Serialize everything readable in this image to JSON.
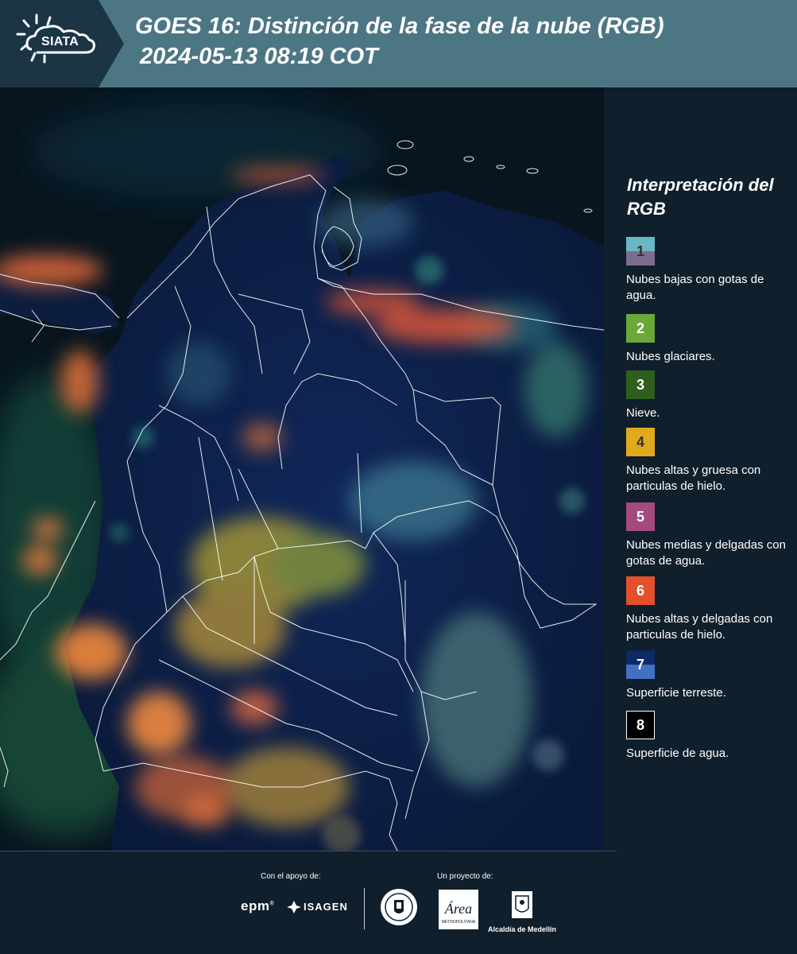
{
  "header": {
    "logo_text": "SIATA",
    "title": "GOES 16: Distinción de la fase de la nube (RGB)",
    "subtitle": "2024-05-13 08:19 COT"
  },
  "legend": {
    "title": "Interpretación del RGB",
    "items": [
      {
        "number": "1",
        "label": "Nubes bajas con gotas de agua.",
        "color_top": "#6ab7c4",
        "color_bottom": "#7a6e8c",
        "num_color": "#333333"
      },
      {
        "number": "2",
        "label": "Nubes glaciares.",
        "color_top": "#6aa83a",
        "color_bottom": "#6aa83a",
        "num_color": "#ffffff"
      },
      {
        "number": "3",
        "label": "Nieve.",
        "color_top": "#2f5e1e",
        "color_bottom": "#2f5e1e",
        "num_color": "#ffffff"
      },
      {
        "number": "4",
        "label": "Nubes altas y gruesa con particulas de hielo.",
        "color_top": "#e0aa1c",
        "color_bottom": "#e0aa1c",
        "num_color": "#333333"
      },
      {
        "number": "5",
        "label": "Nubes medias y delgadas con gotas de agua.",
        "color_top": "#a54a7e",
        "color_bottom": "#a54a7e",
        "num_color": "#ffffff"
      },
      {
        "number": "6",
        "label": "Nubes altas y delgadas con particulas de hielo.",
        "color_top": "#e4502c",
        "color_bottom": "#e4502c",
        "num_color": "#ffffff"
      },
      {
        "number": "7",
        "label": "Superficie terreste.",
        "color_top": "#0e2a66",
        "color_bottom": "#4470c4",
        "num_color": "#ffffff"
      },
      {
        "number": "8",
        "label": "Superficie de agua.",
        "color_top": "#000000",
        "color_bottom": "#000000",
        "num_color": "#ffffff"
      }
    ]
  },
  "footer": {
    "support_label": "Con el apoyo de:",
    "project_label": "Un proyecto de:",
    "epm": "epm",
    "isagen": "ISAGEN",
    "alcaldia": "Alcaldía de Medellín",
    "area_word": "Área",
    "area_sub": "METROPOLITANA"
  },
  "colors": {
    "header_bg": "#4d7684",
    "logo_bg": "#1b3545",
    "legend_bg": "#0f1f2c",
    "map_ocean": "#0a1622",
    "map_land": "#0c1f45"
  }
}
